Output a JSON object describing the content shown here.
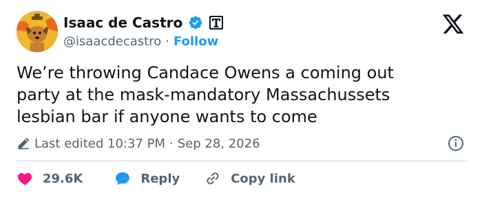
{
  "author": {
    "name": "Isaac de Castro",
    "handle": "@isaacdecastro",
    "separator": "·",
    "follow_label": "Follow"
  },
  "tweet": {
    "lines": [
      "We’re throwing Candace Owens a coming out",
      "party at the mask-mandatory Massachussets",
      "lesbian bar if anyone wants to come"
    ]
  },
  "meta": {
    "edited_label": "Last edited 10:37 PM",
    "separator": "·",
    "date": "Sep 28, 2026"
  },
  "actions": {
    "likes": "29.6K",
    "reply_label": "Reply",
    "copy_link_label": "Copy link"
  },
  "colors": {
    "text": "#0f1419",
    "secondary": "#536471",
    "accent": "#1d9bf0",
    "like": "#f91880",
    "divider": "#cfd9de"
  },
  "icons": {
    "avatar": "dog-this-is-fine-avatar",
    "verified": "verified-badge-icon",
    "affiliation": "affiliation-badge-icon",
    "brand": "x-logo-icon",
    "edited": "pencil-icon",
    "info": "info-icon",
    "like": "heart-icon",
    "reply": "speech-bubble-icon",
    "copy": "link-icon"
  }
}
